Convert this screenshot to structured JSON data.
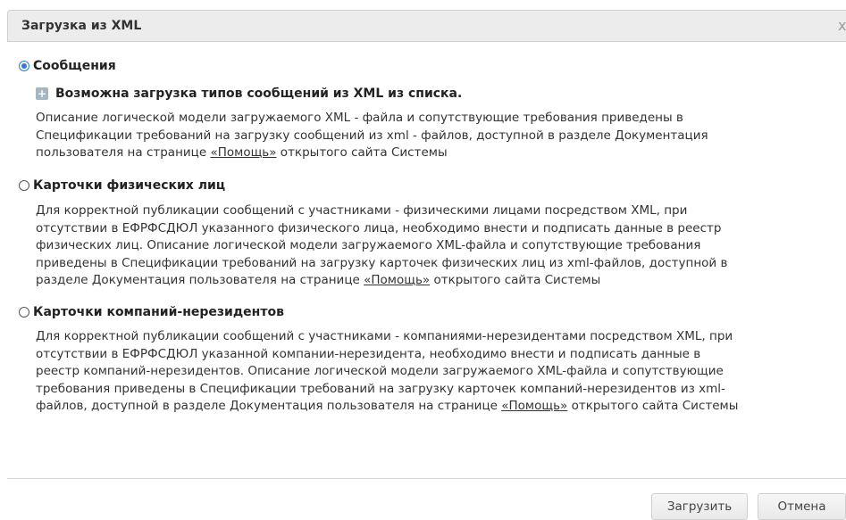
{
  "dialog": {
    "title": "Загрузка из XML",
    "close_glyph": "x"
  },
  "options": [
    {
      "label": "Сообщения",
      "selected": true,
      "expander_label": "Возможна загрузка типов сообщений из XML из списка.",
      "desc_lines": [
        "Описание логической модели загружаемого XML - файла и сопутствующие требования приведены в",
        "Спецификации требований на загрузку сообщений из xml - файлов, доступной в разделе Документация"
      ],
      "last_pre": "пользователя на странице ",
      "link": "«Помощь»",
      "last_post": " открытого сайта Системы"
    },
    {
      "label": "Карточки физических лиц",
      "selected": false,
      "desc_lines": [
        "Для корректной публикации сообщений с участниками - физическими лицами посредством XML, при",
        "отсутствии в ЕФРФСДЮЛ указанного физического лица, необходимо внести и подписать данные в реестр",
        "физических лиц. Описание логической модели загружаемого XML-файла и сопутствующие требования",
        "приведены в Спецификации требований на загрузку карточек физических лиц из xml-файлов, доступной в"
      ],
      "last_pre": "разделе Документация пользователя на странице ",
      "link": "«Помощь»",
      "last_post": " открытого сайта Системы"
    },
    {
      "label": "Карточки компаний-нерезидентов",
      "selected": false,
      "desc_lines": [
        "Для корректной публикации сообщений с участниками - компаниями-нерезидентами посредством XML, при",
        "отсутствии в ЕФРФСДЮЛ указанной компании-нерезидента, необходимо внести и подписать данные в",
        "реестр компаний-нерезидентов. Описание логической модели загружаемого XML-файла и сопутствующие",
        "требования приведены в Спецификации требований на загрузку карточек компаний-нерезидентов из xml-"
      ],
      "last_pre": "файлов, доступной в разделе Документация пользователя на странице ",
      "link": "«Помощь»",
      "last_post": " открытого сайта Системы"
    }
  ],
  "buttons": {
    "upload": "Загрузить",
    "cancel": "Отмена"
  },
  "colors": {
    "radio_selected": "#2f7bd9",
    "titlebar_bg": "#ececec"
  }
}
